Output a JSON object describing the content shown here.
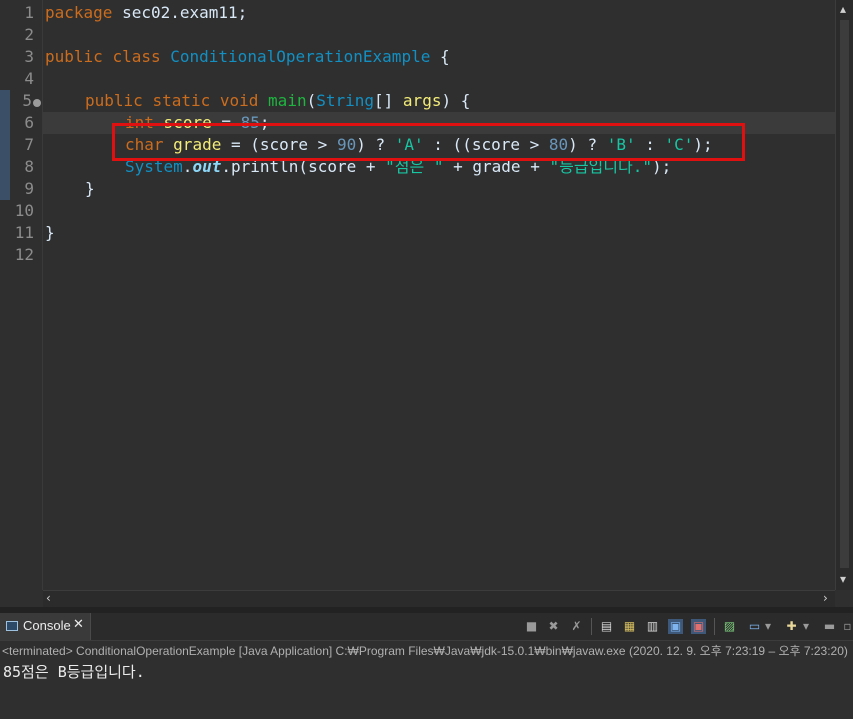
{
  "editor": {
    "line_numbers": [
      "1",
      "2",
      "3",
      "4",
      "5",
      "6",
      "7",
      "8",
      "9",
      "10",
      "11",
      "12"
    ],
    "code": {
      "l1": {
        "kw": "package",
        "rest": " sec02.exam11;"
      },
      "l3": {
        "kw1": "public",
        "kw2": "class",
        "cls": "ConditionalOperationExample",
        "brace": " {"
      },
      "l5": {
        "kw1": "public",
        "kw2": "static",
        "kw3": "void",
        "fn": "main",
        "p1": "(",
        "cls": "String",
        "p2": "[] ",
        "var": "args",
        "p3": ") {"
      },
      "l6": {
        "kw": "int",
        "var": "score",
        "eq": " = ",
        "num": "85",
        "end": ";"
      },
      "l7": {
        "kw": "char",
        "var": "grade",
        "a": " = (",
        "v1": "score",
        "b": " > ",
        "n1": "90",
        "c": ") ? ",
        "s1": "'A'",
        "d": " : ((",
        "v2": "score",
        "e": " > ",
        "n2": "80",
        "f": ") ? ",
        "s2": "'B'",
        "g": " : ",
        "s3": "'C'",
        "h": ");"
      },
      "l8": {
        "cls": "System",
        "dot1": ".",
        "fld": "out",
        "dot2": ".",
        "mth": "println",
        "a": "(",
        "v1": "score",
        "b": " + ",
        "s1": "\"점은 \"",
        "c": " + ",
        "v2": "grade",
        "d": " + ",
        "s2": "\"등급입니다.\"",
        "e": ");"
      },
      "l9": {
        "brace": "}"
      },
      "l11": {
        "brace": "}"
      }
    }
  },
  "console": {
    "tab_label": "Console",
    "close_glyph": "✕",
    "header": "<terminated> ConditionalOperationExample [Java Application] C:₩Program Files₩Java₩jdk-15.0.1₩bin₩javaw.exe  (2020. 12. 9. 오후 7:23:19 – 오후 7:23:20)",
    "output": "85점은 B등급입니다."
  },
  "colors": {
    "background": "#2f2f2f",
    "keyword": "#cc6c1d",
    "class": "#1290c3",
    "variable": "#f3ec79",
    "number": "#6897bb",
    "string": "#17c6a3",
    "highlight_box": "#e01010"
  }
}
